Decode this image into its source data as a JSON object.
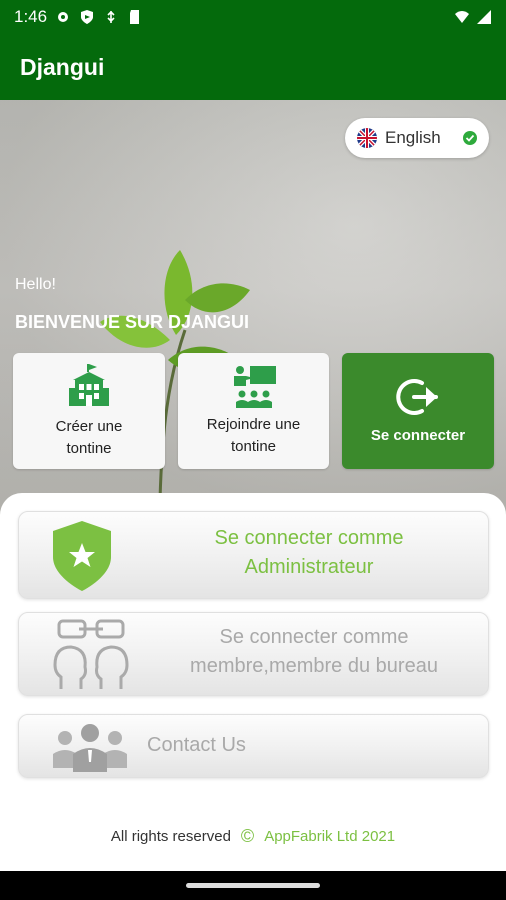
{
  "status_bar": {
    "time": "1:46",
    "left_icons": [
      "settings-icon",
      "shield-icon",
      "usb-icon",
      "sd-card-icon"
    ],
    "right_icons": [
      "wifi-icon",
      "signal-icon"
    ]
  },
  "app_bar": {
    "title": "Djangui"
  },
  "language": {
    "label": "English",
    "flag": "uk-flag-icon",
    "selected": true
  },
  "hero": {
    "greeting": "Hello!",
    "welcome": "BIENVENUE SUR DJANGUI"
  },
  "tiles": [
    {
      "line1": "Créer une",
      "line2": "tontine",
      "icon": "school-building-icon"
    },
    {
      "line1": "Rejoindre une",
      "line2": "tontine",
      "icon": "presentation-board-icon"
    },
    {
      "label": "Se connecter",
      "icon": "login-arrow-icon"
    }
  ],
  "options": [
    {
      "line1": "Se connecter comme",
      "line2": "Administrateur",
      "icon": "shield-star-icon"
    },
    {
      "line1": "Se connecter comme",
      "line2": "membre,membre du bureau",
      "icon": "linked-heads-icon"
    },
    {
      "label": "Contact Us",
      "icon": "group-people-icon"
    }
  ],
  "footer": {
    "rights": "All rights reserved",
    "copyright_symbol": "©",
    "brand": "AppFabrik Ltd 2021"
  },
  "colors": {
    "primary": "#046a0c",
    "accent": "#7cc042",
    "tile_green": "#3b8a2c"
  }
}
